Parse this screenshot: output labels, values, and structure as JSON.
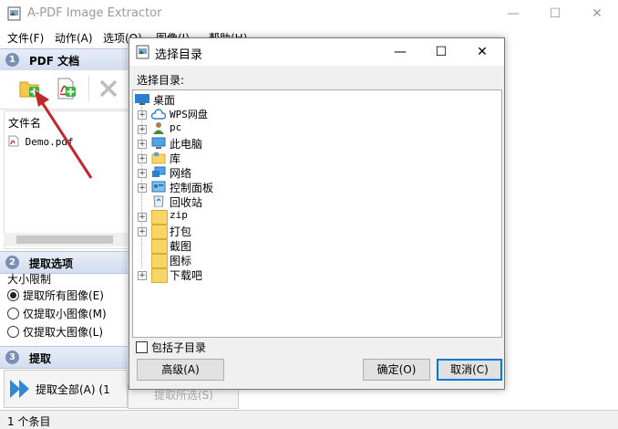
{
  "app": {
    "title": "A-PDF Image Extractor",
    "window_controls": {
      "minimize": "—",
      "maximize": "☐",
      "close": "✕"
    },
    "menu": [
      "文件(F)",
      "动作(A)",
      "选项(O)",
      "图像(I)",
      "帮助(H)"
    ]
  },
  "sections": {
    "pdf": {
      "num": "1",
      "label": "PDF 文档"
    },
    "options": {
      "num": "2",
      "label": "提取选项"
    },
    "extract": {
      "num": "3",
      "label": "提取"
    }
  },
  "file_list": {
    "header": "文件名",
    "files": [
      "Demo.pdf"
    ]
  },
  "options": {
    "group_label": "大小限制",
    "radios": [
      {
        "label": "提取所有图像(E)",
        "selected": true
      },
      {
        "label": "仅提取小图像(M)",
        "selected": false
      },
      {
        "label": "仅提取大图像(L)",
        "selected": false
      }
    ]
  },
  "extract": {
    "all_label": "提取全部(A) (1",
    "selected_label": "提取所选(S)"
  },
  "status": {
    "text": "1 个条目"
  },
  "dialog": {
    "title": "选择目录",
    "label": "选择目录:",
    "tree": [
      {
        "label": "桌面",
        "icon": "desktop-icon"
      },
      {
        "label": "WPS网盘",
        "icon": "cloud-icon",
        "mono": true
      },
      {
        "label": "pc",
        "icon": "user-icon",
        "mono": true
      },
      {
        "label": "此电脑",
        "icon": "computer-icon"
      },
      {
        "label": "库",
        "icon": "library-icon"
      },
      {
        "label": "网络",
        "icon": "network-icon"
      },
      {
        "label": "控制面板",
        "icon": "control-panel-icon"
      },
      {
        "label": "回收站",
        "icon": "recycle-bin-icon"
      },
      {
        "label": "zip",
        "icon": "folder-icon",
        "mono": true
      },
      {
        "label": "打包",
        "icon": "folder-icon"
      },
      {
        "label": "截图",
        "icon": "folder-icon"
      },
      {
        "label": "图标",
        "icon": "folder-icon"
      },
      {
        "label": "下载吧",
        "icon": "folder-icon"
      }
    ],
    "include_subdirs": {
      "label": "包括子目录",
      "checked": false
    },
    "buttons": {
      "advanced": "高级(A)",
      "ok": "确定(O)",
      "cancel": "取消(C)"
    }
  },
  "colors": {
    "accent": "#0078d7",
    "section_bg": "#d3ddef",
    "annotation_arrow": "#c0282a"
  }
}
